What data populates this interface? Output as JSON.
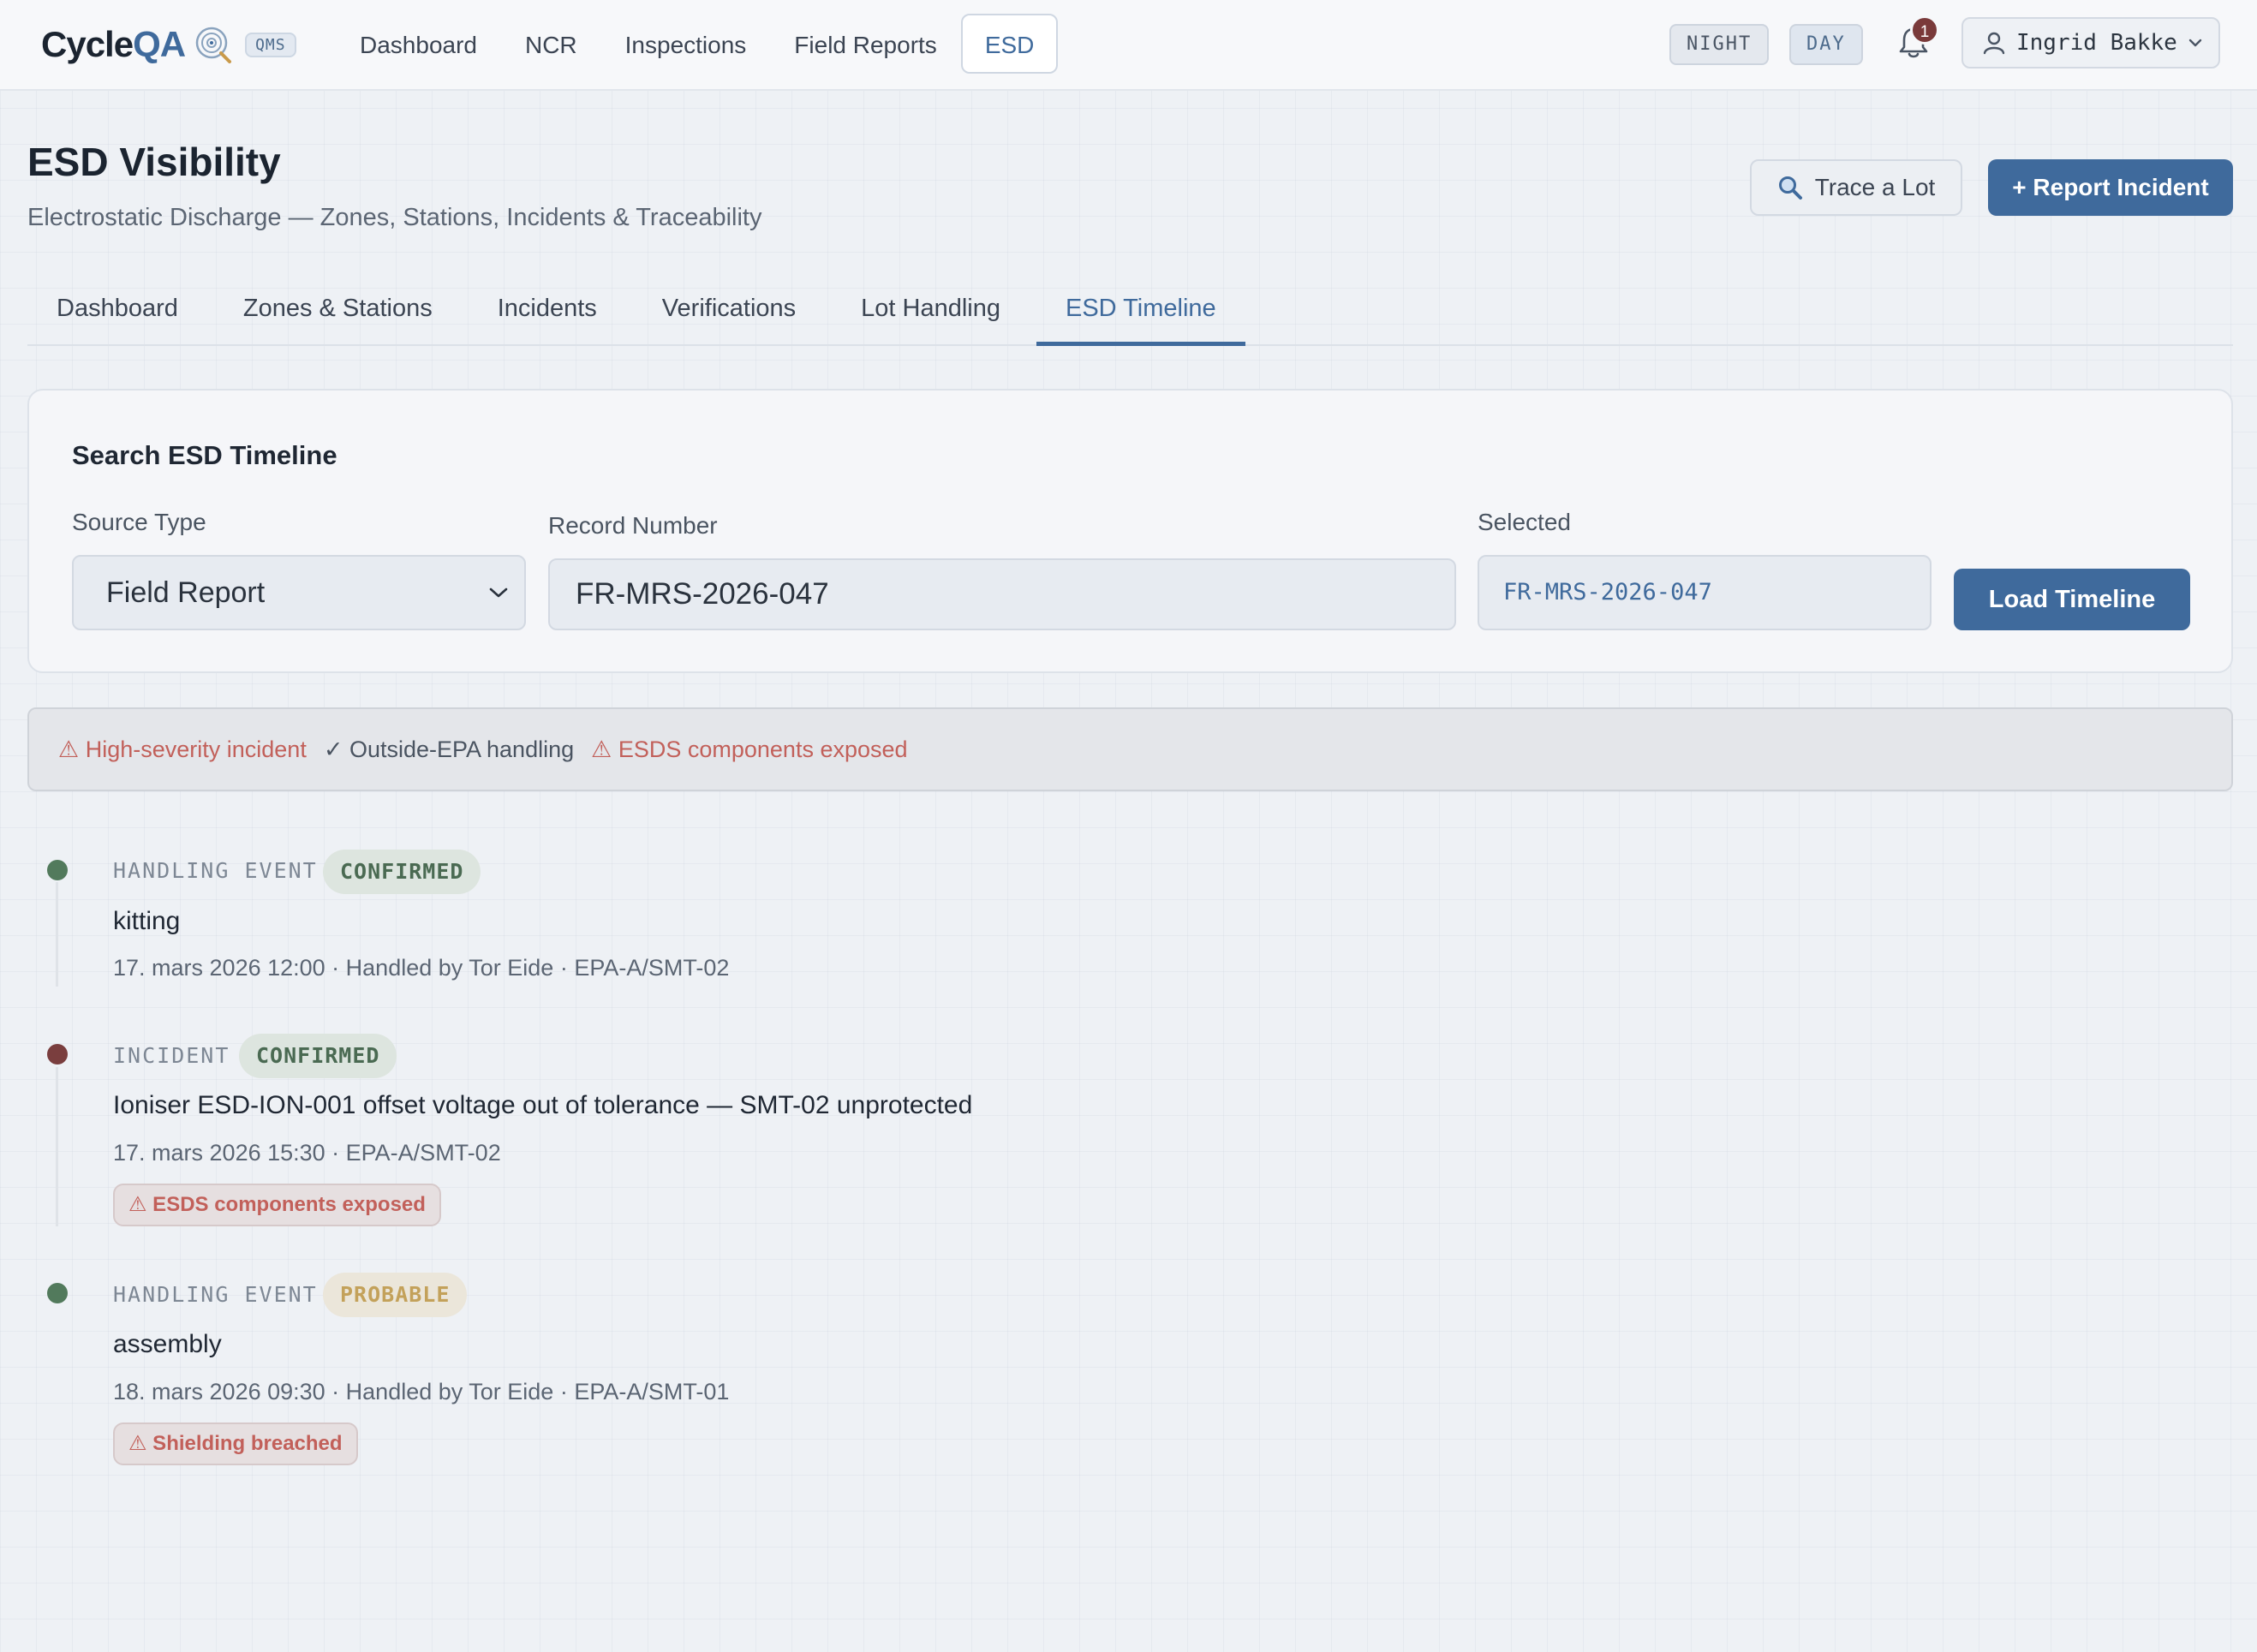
{
  "brand": {
    "name_part1": "Cycle",
    "name_part2": "QA",
    "badge": "QMS"
  },
  "nav": {
    "items": [
      {
        "label": "Dashboard"
      },
      {
        "label": "NCR"
      },
      {
        "label": "Inspections"
      },
      {
        "label": "Field Reports"
      },
      {
        "label": "ESD",
        "active": true
      }
    ],
    "mode_night": "NIGHT",
    "mode_day": "DAY",
    "notifications_count": "1",
    "user_name": "Ingrid Bakke"
  },
  "header": {
    "title": "ESD Visibility",
    "subtitle": "Electrostatic Discharge — Zones, Stations, Incidents & Traceability",
    "trace_button": "Trace a Lot",
    "report_button": "+ Report Incident"
  },
  "tabs": [
    {
      "label": "Dashboard"
    },
    {
      "label": "Zones & Stations"
    },
    {
      "label": "Incidents"
    },
    {
      "label": "Verifications"
    },
    {
      "label": "Lot Handling"
    },
    {
      "label": "ESD Timeline",
      "active": true
    }
  ],
  "search": {
    "title": "Search ESD Timeline",
    "source_type_label": "Source Type",
    "source_type_value": "Field Report",
    "record_number_label": "Record Number",
    "record_number_value": "FR-MRS-2026-047",
    "selected_label": "Selected",
    "selected_value": "FR-MRS-2026-047",
    "load_button": "Load Timeline"
  },
  "flags": [
    {
      "text": "⚠ High-severity incident",
      "kind": "warn"
    },
    {
      "text": "✓ Outside-EPA handling",
      "kind": "ok"
    },
    {
      "text": "⚠ ESDS components exposed",
      "kind": "warn"
    }
  ],
  "timeline": [
    {
      "kind": "HANDLING EVENT",
      "status": "CONFIRMED",
      "title": "kitting",
      "meta": "17. mars 2026 12:00 · Handled by Tor Eide · EPA-A/SMT-02",
      "badge": ""
    },
    {
      "kind": "INCIDENT",
      "status": "CONFIRMED",
      "title": "Ioniser ESD-ION-001 offset voltage out of tolerance — SMT-02 unprotected",
      "meta": "17. mars 2026 15:30 · EPA-A/SMT-02",
      "badge": "⚠ ESDS components exposed"
    },
    {
      "kind": "HANDLING EVENT",
      "status": "PROBABLE",
      "title": "assembly",
      "meta": "18. mars 2026 09:30 · Handled by Tor Eide · EPA-A/SMT-01",
      "badge": "⚠ Shielding breached"
    }
  ],
  "colors": {
    "accent": "#3f6a9c",
    "warning": "#c2605a",
    "confirmed": "#4a6a52",
    "probable": "#c3a15a"
  }
}
